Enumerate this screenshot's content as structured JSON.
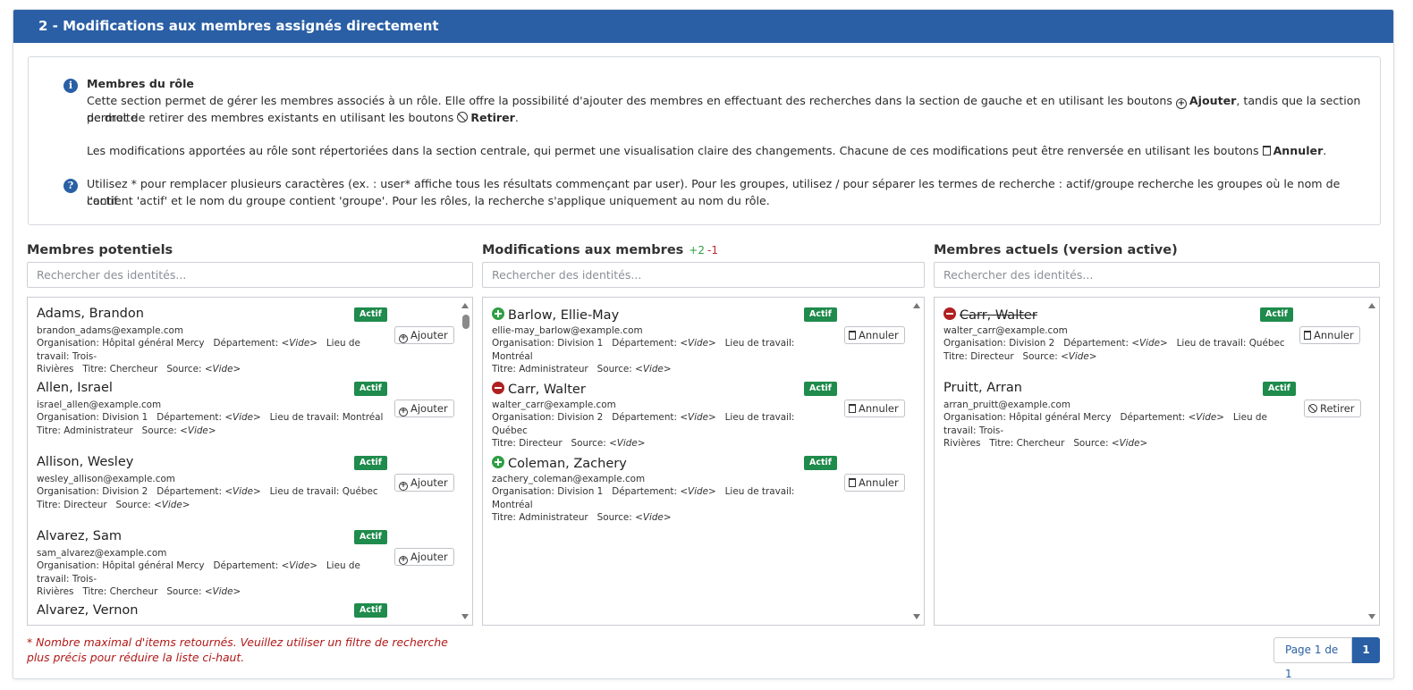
{
  "header": {
    "title": "2 - Modifications aux membres assignés directement"
  },
  "info": {
    "title": "Membres du rôle",
    "p1_a": "Cette section permet de gérer les membres associés à un rôle. Elle offre la possibilité d'ajouter des membres en effectuant des recherches dans la section de gauche et en utilisant les boutons ",
    "p1_add": "Ajouter",
    "p1_b": ", tandis que la section de droite",
    "p1_c": "permet de retirer des membres existants en utilisant les boutons ",
    "p1_remove": "Retirer",
    "p1_d": ".",
    "p2_a": "Les modifications apportées au rôle sont répertoriées dans la section centrale, qui permet une visualisation claire des changements. Chacune de ces modifications peut être renversée en utilisant les boutons ",
    "p2_cancel": "Annuler",
    "p2_b": ".",
    "help_1": "Utilisez * pour remplacer plusieurs caractères (ex. : user* affiche tous les résultats commençant par user). Pour les groupes, utilisez / pour séparer les termes de recherche : actif/groupe recherche les groupes où le nom de l'actif",
    "help_2": "contient 'actif' et le nom du groupe contient 'groupe'. Pour les rôles, la recherche s'applique uniquement au nom du rôle."
  },
  "columns": {
    "potential": {
      "title": "Membres potentiels",
      "placeholder": "Rechercher des identités..."
    },
    "changes": {
      "title": "Modifications aux membres",
      "added": "+2",
      "removed": "-1",
      "placeholder": "Rechercher des identités..."
    },
    "current": {
      "title": "Membres actuels (version active)",
      "placeholder": "Rechercher des identités..."
    }
  },
  "labels": {
    "org": "Organisation:",
    "dept": "Département:",
    "loc": "Lieu de travail:",
    "title": "Titre:",
    "source": "Source:",
    "empty": "<Vide>",
    "active": "Actif",
    "add": "Ajouter",
    "cancel": "Annuler",
    "remove": "Retirer"
  },
  "potential": [
    {
      "name": "Adams, Brandon",
      "email": "brandon_adams@example.com",
      "org": "Hôpital général Mercy",
      "loc_a": "Trois-",
      "loc_b": "Rivières",
      "title": "Chercheur"
    },
    {
      "name": "Allen, Israel",
      "email": "israel_allen@example.com",
      "org": "Division 1",
      "loc": "Montréal",
      "title": "Administrateur"
    },
    {
      "name": "Allison, Wesley",
      "email": "wesley_allison@example.com",
      "org": "Division 2",
      "loc": "Québec",
      "title": "Directeur"
    },
    {
      "name": "Alvarez, Sam",
      "email": "sam_alvarez@example.com",
      "org": "Hôpital général Mercy",
      "loc_a": "Trois-",
      "loc_b": "Rivières",
      "title": "Chercheur"
    },
    {
      "name": "Alvarez, Vernon"
    }
  ],
  "changes": [
    {
      "name": "Barlow, Ellie-May",
      "email": "ellie-may_barlow@example.com",
      "org": "Division 1",
      "loc": "Montréal",
      "title": "Administrateur",
      "kind": "add"
    },
    {
      "name": "Carr, Walter",
      "email": "walter_carr@example.com",
      "org": "Division 2",
      "loc": "Québec",
      "title": "Directeur",
      "kind": "remove"
    },
    {
      "name": "Coleman, Zachery",
      "email": "zachery_coleman@example.com",
      "org": "Division 1",
      "loc": "Montréal",
      "title": "Administrateur",
      "kind": "add"
    }
  ],
  "current": [
    {
      "name": "Carr, Walter",
      "email": "walter_carr@example.com",
      "org": "Division 2",
      "loc": "Québec",
      "title": "Directeur",
      "pending": "remove"
    },
    {
      "name": "Pruitt, Arran",
      "email": "arran_pruitt@example.com",
      "org": "Hôpital général Mercy",
      "loc_a": "Trois-",
      "loc_b": "Rivières",
      "title": "Chercheur"
    }
  ],
  "footnote": "* Nombre maximal d'items retournés. Veuillez utiliser un filtre de recherche plus précis pour réduire la liste ci-haut.",
  "pager": {
    "info": "Page 1 de 1",
    "page": "1"
  },
  "colors": {
    "header": "#2a5fa5",
    "badge": "#1f8b4c",
    "add": "#2f9e44",
    "remove": "#b02020",
    "footnote": "#b01818"
  }
}
